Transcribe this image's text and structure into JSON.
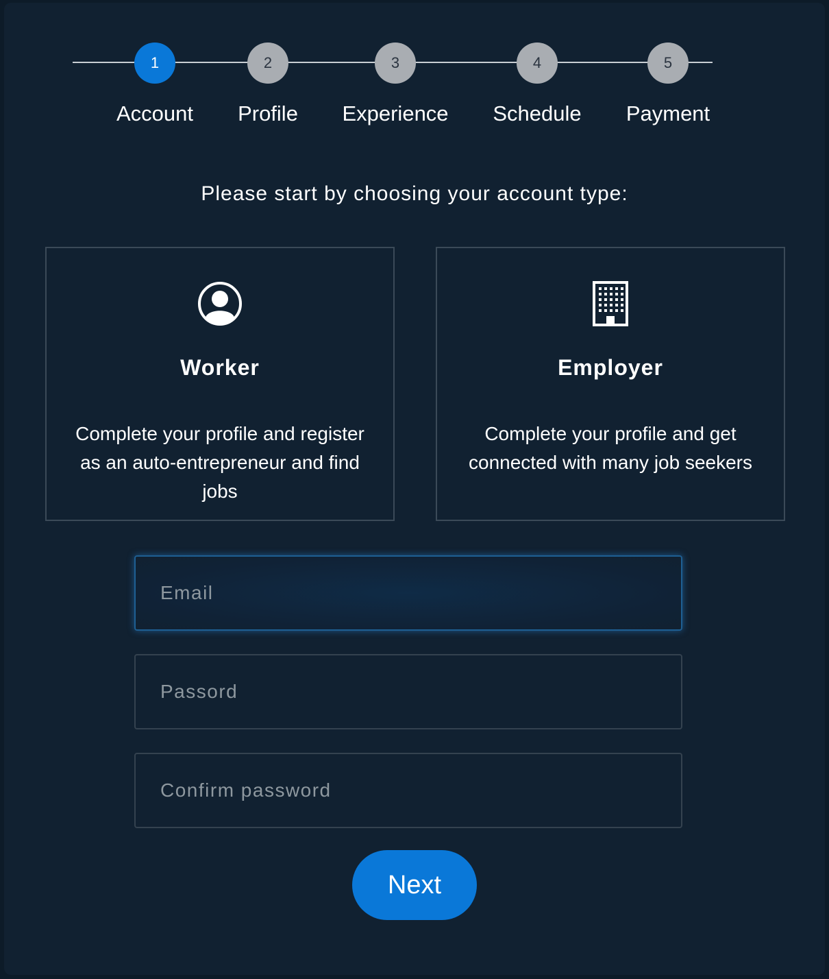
{
  "stepper": {
    "steps": [
      {
        "number": "1",
        "label": "Account",
        "active": true
      },
      {
        "number": "2",
        "label": "Profile",
        "active": false
      },
      {
        "number": "3",
        "label": "Experience",
        "active": false
      },
      {
        "number": "4",
        "label": "Schedule",
        "active": false
      },
      {
        "number": "5",
        "label": "Payment",
        "active": false
      }
    ]
  },
  "prompt": "Please start by choosing your account type:",
  "account_types": [
    {
      "icon": "user-circle-icon",
      "title": "Worker",
      "description": "Complete your profile and register as an auto-entrepreneur and find jobs"
    },
    {
      "icon": "building-icon",
      "title": "Employer",
      "description": "Complete your profile and get connected with many job seekers"
    }
  ],
  "form": {
    "email_placeholder": "Email",
    "password_placeholder": "Passord",
    "confirm_placeholder": "Confirm password",
    "next_label": "Next"
  },
  "colors": {
    "accent": "#0a78d8",
    "background": "#112131",
    "inactive_step": "#a9adb2"
  }
}
